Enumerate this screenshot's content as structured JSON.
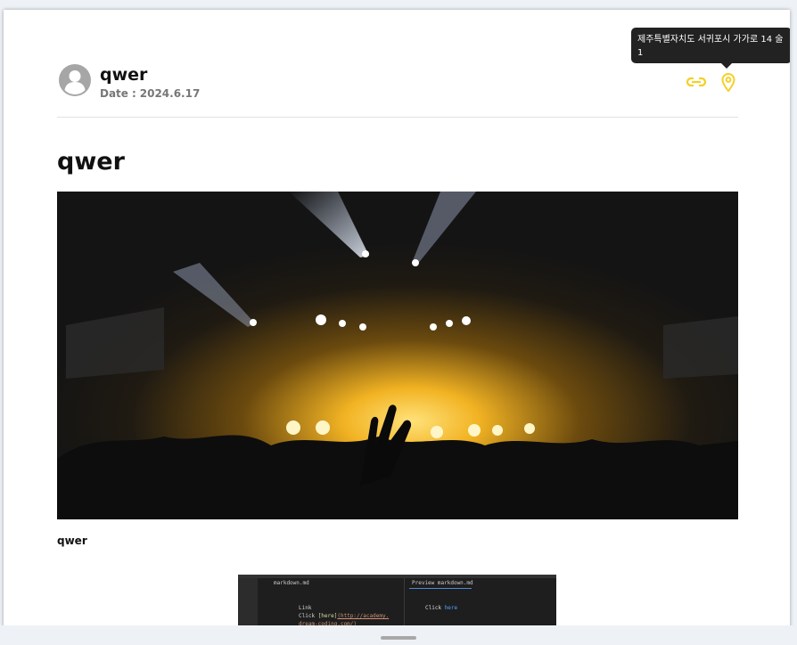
{
  "post": {
    "author": "qwer",
    "date_label": "Date",
    "date_separator": ":",
    "date": "2024.6.17",
    "title": "qwer",
    "image_caption": "qwer"
  },
  "tooltip": {
    "location_text": "제주특별자치도 서귀포시 가가로 14 술1"
  },
  "icons": {
    "avatar": "user-avatar-icon",
    "link": "link-icon",
    "location": "map-pin-icon"
  },
  "editor_screenshot": {
    "left_tab": "markdown.md",
    "right_tab": "Preview markdown.md",
    "code_heading": "Link",
    "code_prefix": "Click ",
    "code_link_text": "[here]",
    "code_url_1": "(http://academy.",
    "code_url_2": "dream-coding.com/)",
    "preview_prefix": "Click ",
    "preview_link": "here"
  },
  "colors": {
    "accent": "#f5d026",
    "avatar_grey": "#a6a6a6",
    "tooltip_bg": "#222222",
    "text_primary": "#111111",
    "text_muted": "#777777"
  }
}
